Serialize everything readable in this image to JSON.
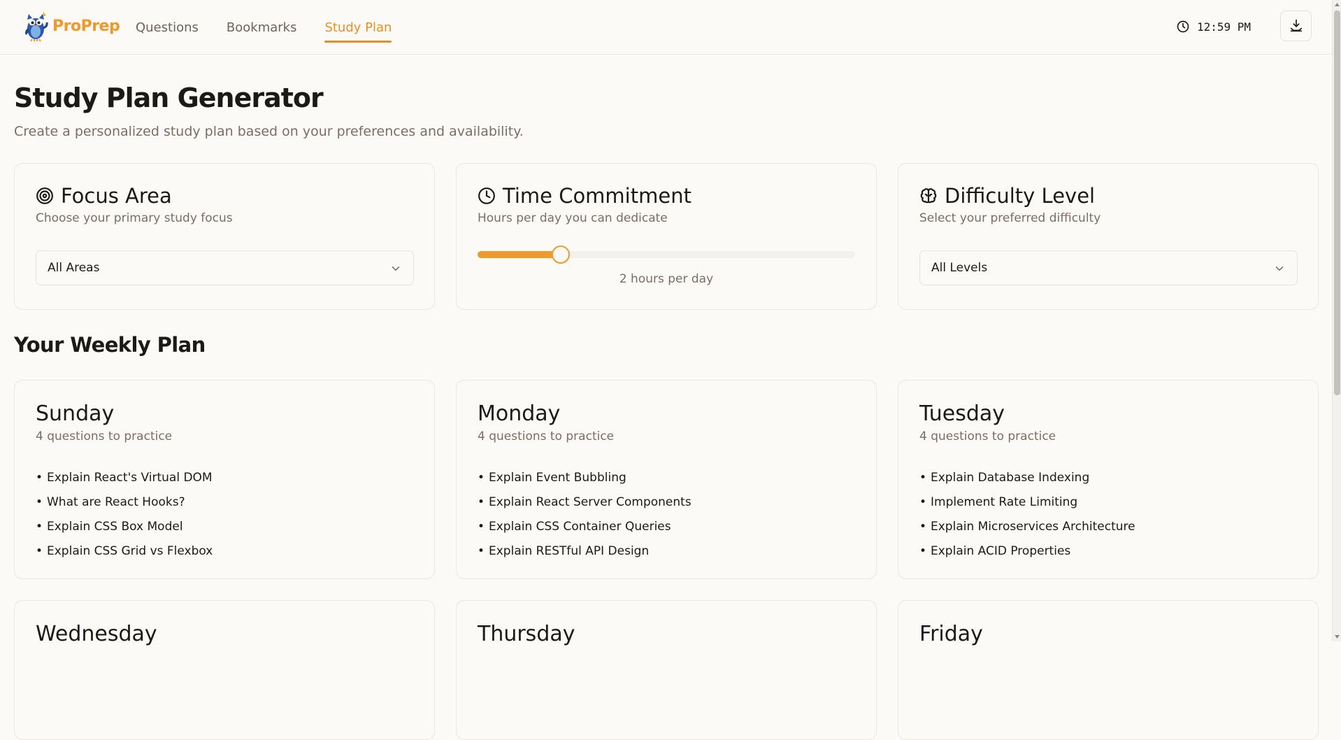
{
  "header": {
    "brand_name": "ProPrep",
    "nav": [
      {
        "label": "Questions"
      },
      {
        "label": "Bookmarks"
      },
      {
        "label": "Study Plan",
        "active": true
      }
    ],
    "clock_time": "12:59 PM",
    "accent_color": "#e8901f",
    "install_icon": "download-tray-icon"
  },
  "page": {
    "title": "Study Plan Generator",
    "subtitle": "Create a personalized study plan based on your preferences and availability."
  },
  "preferences": {
    "focus": {
      "icon": "target-icon",
      "title": "Focus Area",
      "description": "Choose your primary study focus",
      "selected": "All Areas"
    },
    "time": {
      "icon": "clock-icon",
      "title": "Time Commitment",
      "description": "Hours per day you can dedicate",
      "slider_fraction": 0.22,
      "value_label": "2 hours per day"
    },
    "difficulty": {
      "icon": "brain-icon",
      "title": "Difficulty Level",
      "description": "Select your preferred difficulty",
      "selected": "All Levels"
    }
  },
  "weekly_plan": {
    "title": "Your Weekly Plan",
    "bullet": "•",
    "days": [
      {
        "name": "Sunday",
        "count_label": "4 questions to practice",
        "questions": [
          "Explain React's Virtual DOM",
          "What are React Hooks?",
          "Explain CSS Box Model",
          "Explain CSS Grid vs Flexbox"
        ]
      },
      {
        "name": "Monday",
        "count_label": "4 questions to practice",
        "questions": [
          "Explain Event Bubbling",
          "Explain React Server Components",
          "Explain CSS Container Queries",
          "Explain RESTful API Design"
        ]
      },
      {
        "name": "Tuesday",
        "count_label": "4 questions to practice",
        "questions": [
          "Explain Database Indexing",
          "Implement Rate Limiting",
          "Explain Microservices Architecture",
          "Explain ACID Properties"
        ]
      },
      {
        "name": "Wednesday"
      },
      {
        "name": "Thursday"
      },
      {
        "name": "Friday"
      }
    ]
  }
}
